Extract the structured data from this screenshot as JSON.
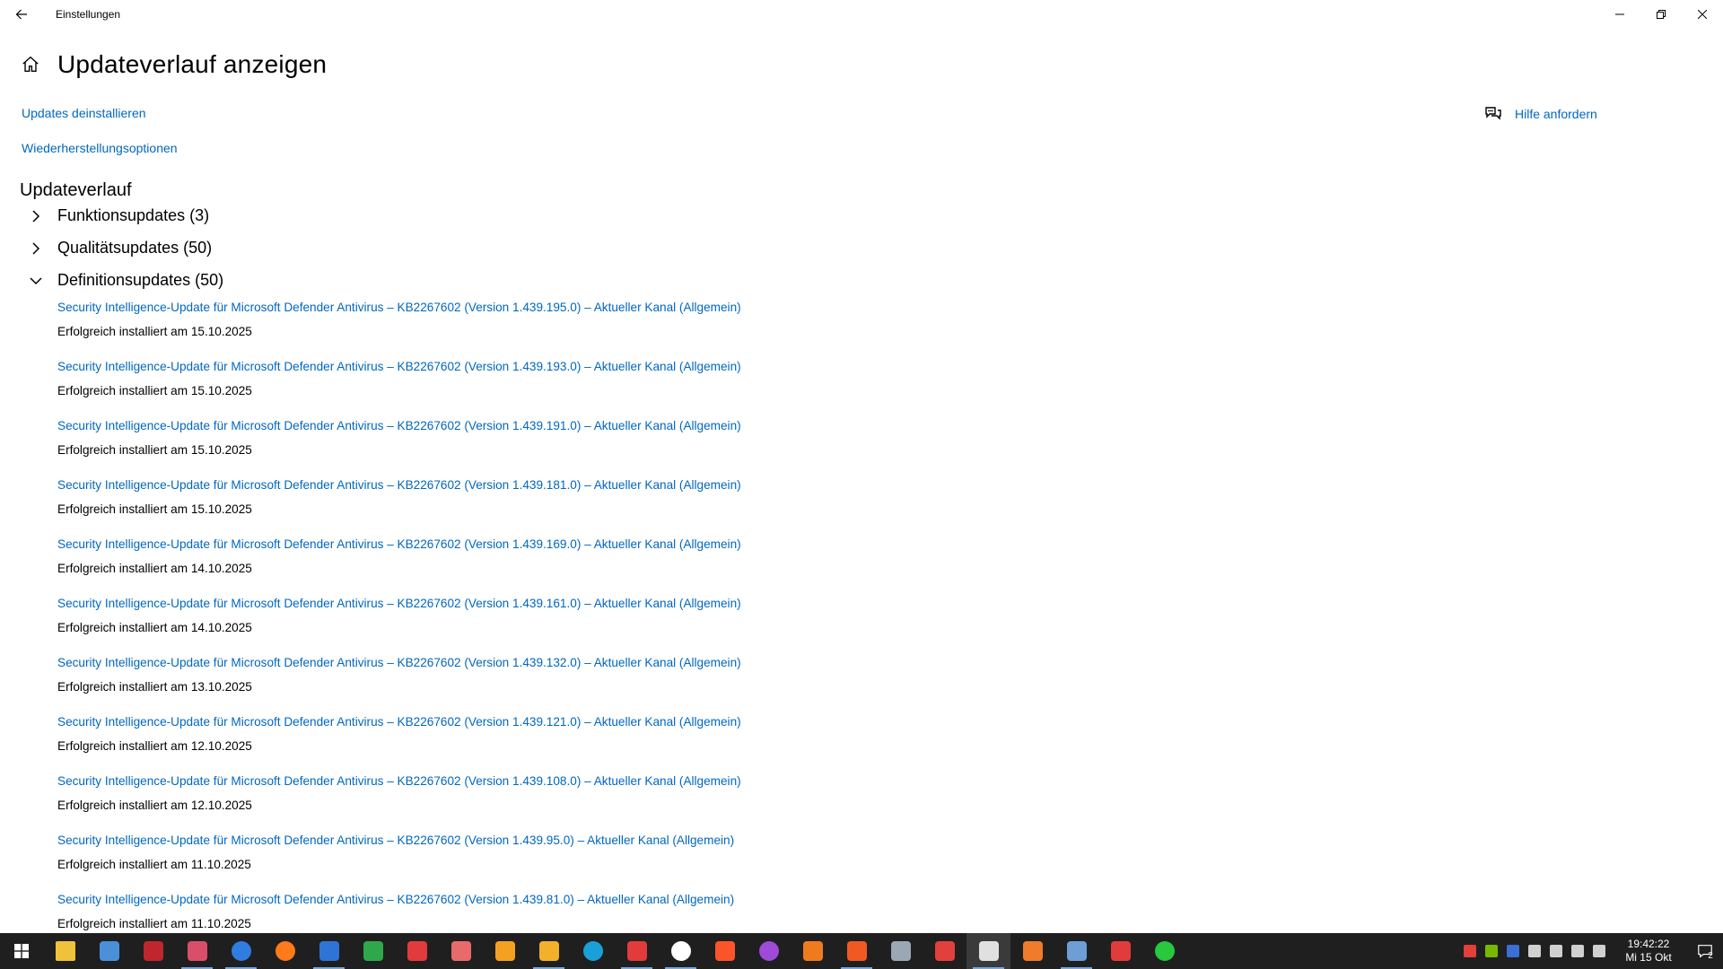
{
  "window": {
    "title": "Einstellungen"
  },
  "page": {
    "title": "Updateverlauf anzeigen",
    "links": [
      {
        "label": "Updates deinstallieren"
      },
      {
        "label": "Wiederherstellungsoptionen"
      }
    ],
    "help_label": "Hilfe anfordern",
    "section_title": "Updateverlauf"
  },
  "groups": [
    {
      "label": "Funktionsupdates (3)",
      "expanded": false
    },
    {
      "label": "Qualitätsupdates (50)",
      "expanded": false
    },
    {
      "label": "Definitionsupdates (50)",
      "expanded": true
    }
  ],
  "updates": [
    {
      "title": "Security Intelligence-Update für Microsoft Defender Antivirus – KB2267602 (Version 1.439.195.0) – Aktueller Kanal (Allgemein)",
      "status": "Erfolgreich installiert am 15.10.2025"
    },
    {
      "title": "Security Intelligence-Update für Microsoft Defender Antivirus – KB2267602 (Version 1.439.193.0) – Aktueller Kanal (Allgemein)",
      "status": "Erfolgreich installiert am 15.10.2025"
    },
    {
      "title": "Security Intelligence-Update für Microsoft Defender Antivirus – KB2267602 (Version 1.439.191.0) – Aktueller Kanal (Allgemein)",
      "status": "Erfolgreich installiert am 15.10.2025"
    },
    {
      "title": "Security Intelligence-Update für Microsoft Defender Antivirus – KB2267602 (Version 1.439.181.0) – Aktueller Kanal (Allgemein)",
      "status": "Erfolgreich installiert am 15.10.2025"
    },
    {
      "title": "Security Intelligence-Update für Microsoft Defender Antivirus – KB2267602 (Version 1.439.169.0) – Aktueller Kanal (Allgemein)",
      "status": "Erfolgreich installiert am 14.10.2025"
    },
    {
      "title": "Security Intelligence-Update für Microsoft Defender Antivirus – KB2267602 (Version 1.439.161.0) – Aktueller Kanal (Allgemein)",
      "status": "Erfolgreich installiert am 14.10.2025"
    },
    {
      "title": "Security Intelligence-Update für Microsoft Defender Antivirus – KB2267602 (Version 1.439.132.0) – Aktueller Kanal (Allgemein)",
      "status": "Erfolgreich installiert am 13.10.2025"
    },
    {
      "title": "Security Intelligence-Update für Microsoft Defender Antivirus – KB2267602 (Version 1.439.121.0) – Aktueller Kanal (Allgemein)",
      "status": "Erfolgreich installiert am 12.10.2025"
    },
    {
      "title": "Security Intelligence-Update für Microsoft Defender Antivirus – KB2267602 (Version 1.439.108.0) – Aktueller Kanal (Allgemein)",
      "status": "Erfolgreich installiert am 12.10.2025"
    },
    {
      "title": "Security Intelligence-Update für Microsoft Defender Antivirus – KB2267602 (Version 1.439.95.0) – Aktueller Kanal (Allgemein)",
      "status": "Erfolgreich installiert am 11.10.2025"
    },
    {
      "title": "Security Intelligence-Update für Microsoft Defender Antivirus – KB2267602 (Version 1.439.81.0) – Aktueller Kanal (Allgemein)",
      "status": "Erfolgreich installiert am 11.10.2025"
    }
  ],
  "taskbar": {
    "apps": [
      {
        "name": "file-explorer-icon",
        "color": "#f0c23b"
      },
      {
        "name": "window-app-icon",
        "color": "#4a90d9"
      },
      {
        "name": "red-app-icon",
        "color": "#c0262d"
      },
      {
        "name": "eye-app-icon",
        "color": "#d94f6a"
      },
      {
        "name": "blue-globe-icon",
        "color": "#2f7de1"
      },
      {
        "name": "firefox-icon",
        "color": "#ff7a1a"
      },
      {
        "name": "writer-doc-icon",
        "color": "#2e74d6"
      },
      {
        "name": "spreadsheet-icon",
        "color": "#2ea84a"
      },
      {
        "name": "tools-app-icon",
        "color": "#e23b3b"
      },
      {
        "name": "rocket-app-icon",
        "color": "#e86a6a"
      },
      {
        "name": "crown-app-icon",
        "color": "#f4a020"
      },
      {
        "name": "chrome-style-icon",
        "color": "#f3b02a"
      },
      {
        "name": "edge-icon",
        "color": "#1aa0d9"
      },
      {
        "name": "opera-style-icon",
        "color": "#e13b3b"
      },
      {
        "name": "vivaldi-icon",
        "color": "#ffffff"
      },
      {
        "name": "brave-icon",
        "color": "#fb542b"
      },
      {
        "name": "tor-style-icon",
        "color": "#9d4bd8"
      },
      {
        "name": "avast-style-icon",
        "color": "#f07a1e"
      },
      {
        "name": "orange-square-icon",
        "color": "#f05a22"
      },
      {
        "name": "mail-app-icon",
        "color": "#9aa7b5"
      },
      {
        "name": "cancel-app-icon",
        "color": "#e2403b"
      },
      {
        "name": "settings-gear-icon",
        "color": "#e0e0e0"
      },
      {
        "name": "orange-app-icon",
        "color": "#f07b2a"
      },
      {
        "name": "image-viewer-icon",
        "color": "#6d9ed6"
      },
      {
        "name": "red-curve-icon",
        "color": "#e23b3b"
      },
      {
        "name": "green-u-icon",
        "color": "#27c93f"
      }
    ],
    "active_index": 21,
    "underlined": [
      3,
      4,
      6,
      11,
      13,
      14,
      18,
      21,
      23
    ],
    "tray": [
      {
        "name": "shield-tray-icon",
        "color": "#e2403b"
      },
      {
        "name": "nvidia-tray-icon",
        "color": "#76b900"
      },
      {
        "name": "blue-tray-icon",
        "color": "#3b6fd8"
      },
      {
        "name": "usb-tray-icon",
        "color": "#d0d0d0"
      },
      {
        "name": "pen-tray-icon",
        "color": "#d0d0d0"
      },
      {
        "name": "network-tray-icon",
        "color": "#d0d0d0"
      },
      {
        "name": "volume-tray-icon",
        "color": "#d0d0d0"
      }
    ],
    "time": "19:42:22",
    "date": "Mi 15 Okt",
    "notification_count": "2"
  }
}
